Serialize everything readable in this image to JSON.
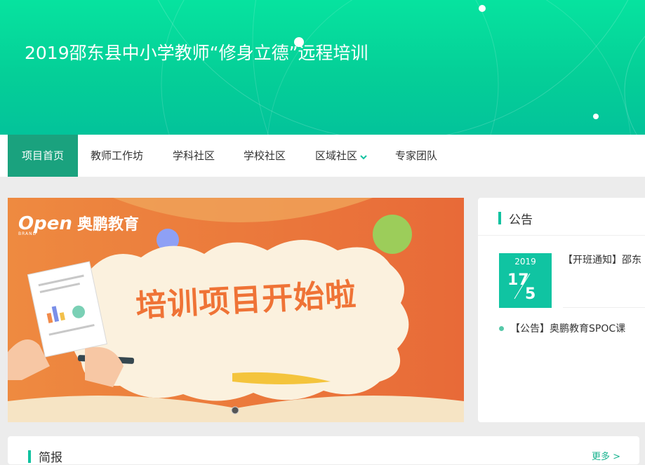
{
  "header": {
    "title": "2019邵东县中小学教师“修身立德”远程培训"
  },
  "nav": {
    "items": [
      "项目首页",
      "教师工作坊",
      "学科社区",
      "学校社区",
      "区域社区",
      "专家团队"
    ],
    "active": "项目首页"
  },
  "banner": {
    "brand_logo": "Open",
    "brand_sub": "BRAND",
    "brand_name": "奥鹏教育",
    "headline": "培训项目开始啦"
  },
  "notice": {
    "title": "公告",
    "featured": {
      "year": "2019",
      "day": "17",
      "month": "5",
      "text": "【开班通知】邵东"
    },
    "items": [
      "【公告】奥鹏教育SPOC课"
    ]
  },
  "brief": {
    "title": "简报",
    "more": "更多 >"
  },
  "colors": {
    "header_green": "#05d69a",
    "nav_active": "#1aa27e",
    "accent": "#10c2a0",
    "banner_orange": "#ee7f3a"
  }
}
